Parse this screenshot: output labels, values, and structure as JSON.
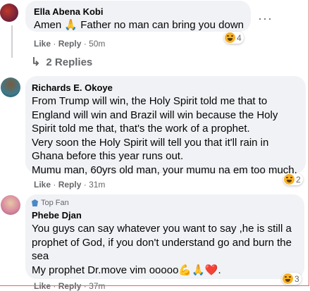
{
  "comments": [
    {
      "author": "Ella Abena Kobi",
      "text": "Amen 🙏 Father no man can bring you down",
      "like_label": "Like",
      "reply_label": "Reply",
      "time": "50m",
      "reaction_count": "4",
      "replies_label": "2 Replies"
    },
    {
      "author": "Richards E. Okoye",
      "lines": [
        "From Trump will win, the Holy Spirit told me that to",
        "England will win and Brazil will win because the Holy",
        "Spirit told me that, that's the work of a prophet.",
        "Very soon the Holy Spirit will tell you that it'll rain in",
        "Ghana before this year runs out.",
        "Mumu man, 60yrs old man, your mumu na em too much."
      ],
      "like_label": "Like",
      "reply_label": "Reply",
      "time": "31m",
      "reaction_count": "2"
    },
    {
      "badge": "Top Fan",
      "author": "Phebe Djan",
      "lines": [
        "You guys can say whatever you want to say ,he is still a",
        "prophet of God, if you don't understand go and burn the",
        "sea",
        "My prophet Dr.move vim ooooo💪🙏❤️."
      ],
      "like_label": "Like",
      "reply_label": "Reply",
      "time": "37m",
      "reaction_count": "3"
    }
  ],
  "more_icon_glyph": "···",
  "reply_arrow_glyph": "↳",
  "dot_separator": "·"
}
